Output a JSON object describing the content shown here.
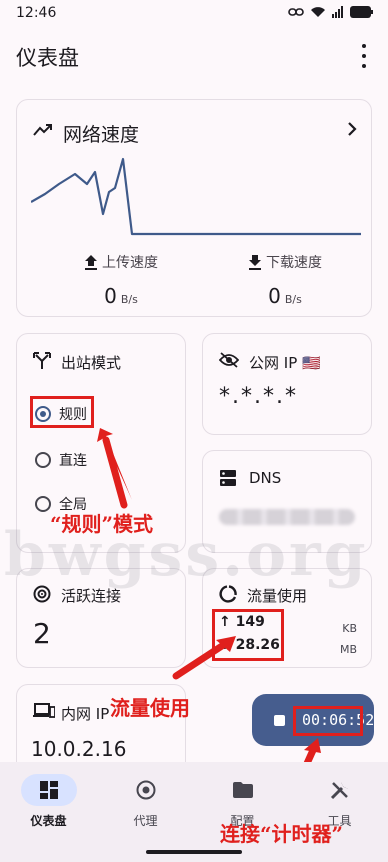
{
  "status_bar": {
    "time": "12:46"
  },
  "app_bar": {
    "title": "仪表盘",
    "menu_icon": "more-vert-icon"
  },
  "speed_card": {
    "title": "网络速度",
    "upload": {
      "label": "上传速度",
      "value": "0",
      "unit": "B/s"
    },
    "download": {
      "label": "下载速度",
      "value": "0",
      "unit": "B/s"
    }
  },
  "outbound_card": {
    "title": "出站模式",
    "options": [
      {
        "label": "规则",
        "selected": true
      },
      {
        "label": "直连",
        "selected": false
      },
      {
        "label": "全局",
        "selected": false
      }
    ]
  },
  "ip_card": {
    "title": "公网 IP",
    "flag": "🇺🇸",
    "value": "*.*.*.*"
  },
  "dns_card": {
    "title": "DNS"
  },
  "active_card": {
    "title": "活跃连接",
    "value": "2"
  },
  "traffic_card": {
    "title": "流量使用",
    "up_arrow": "↑",
    "up_value": "149",
    "up_unit": "KB",
    "down_arrow": "↓",
    "down_value": "28.26",
    "down_unit": "MB"
  },
  "lan_card": {
    "title": "内网 IP",
    "value": "10.0.2.16"
  },
  "timer": {
    "value": "00:06:52"
  },
  "nav": [
    {
      "label": "仪表盘",
      "active": true
    },
    {
      "label": "代理",
      "active": false
    },
    {
      "label": "配置",
      "active": false
    },
    {
      "label": "工具",
      "active": false
    }
  ],
  "annotations": {
    "mode": "“规则”模式",
    "traffic": "流量使用",
    "timer": "连接“计时器”"
  },
  "watermark": "bwgss.org",
  "colors": {
    "accent": "#465d8e",
    "annotation": "#e0201d",
    "nav_active": "#d8e2ff"
  }
}
